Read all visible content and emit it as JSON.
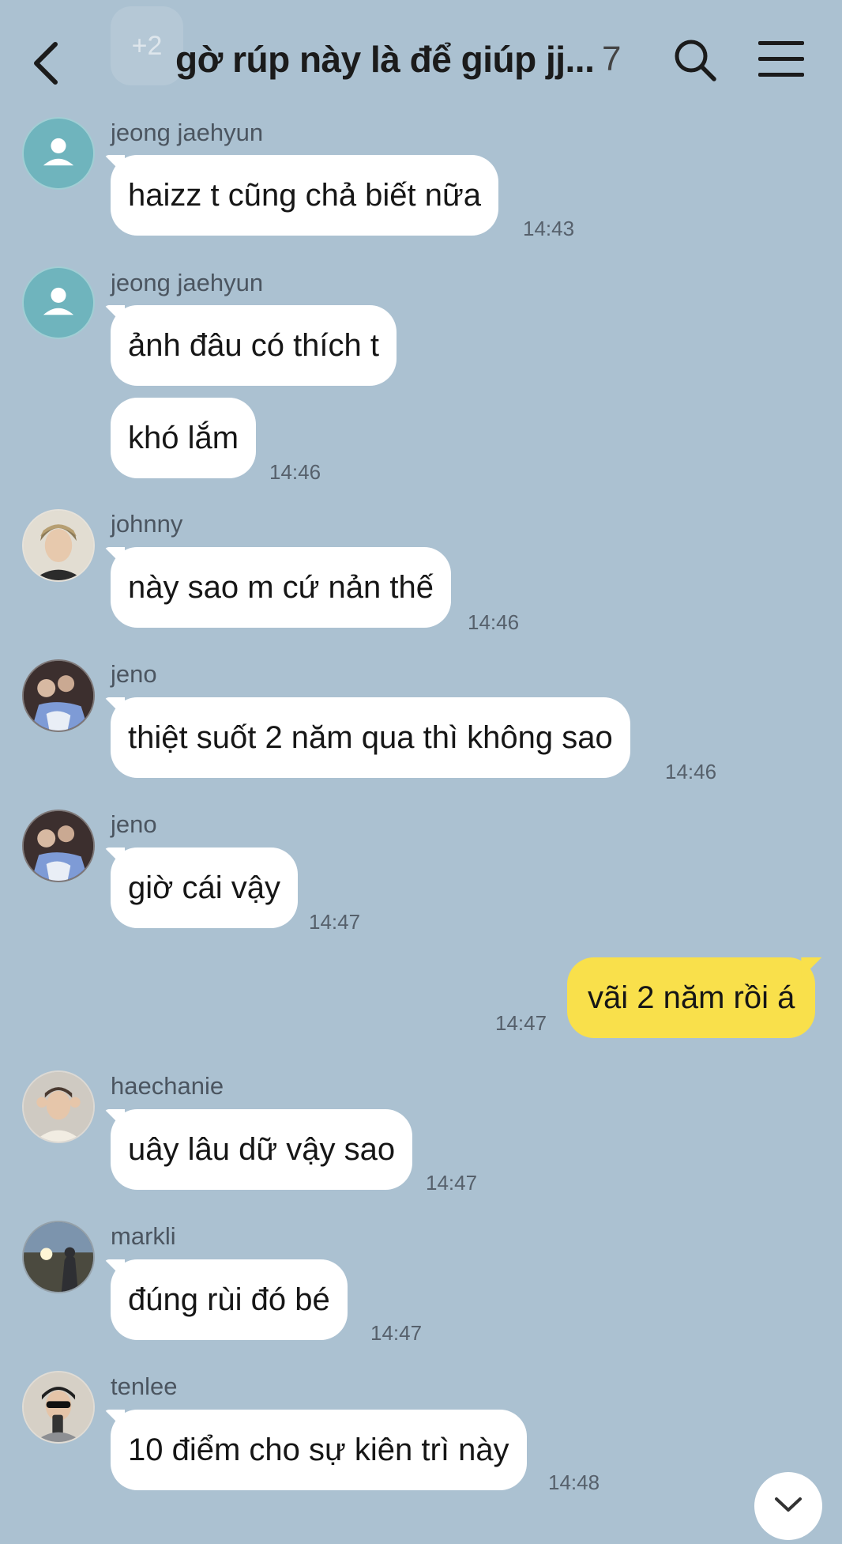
{
  "header": {
    "title": "gờ rúp này là để giúp jj...",
    "member_count": "7",
    "ghost_badge": "+2"
  },
  "messages": [
    {
      "sender": "jeong jaehyun",
      "text": "haizz t cũng chả biết nữa",
      "time": "14:43"
    },
    {
      "sender": "jeong jaehyun",
      "text": "ảnh đâu có thích t"
    },
    {
      "text": "khó lắm",
      "time": "14:46"
    },
    {
      "sender": "johnny",
      "text": "này sao m cứ nản thế",
      "time": "14:46"
    },
    {
      "sender": "jeno",
      "text": "thiệt suốt 2 năm qua thì không sao",
      "time": "14:46"
    },
    {
      "sender": "jeno",
      "text": "giờ cái vậy",
      "time": "14:47"
    },
    {
      "text": "vãi 2 năm rồi á",
      "time": "14:47",
      "mine": true
    },
    {
      "sender": "haechanie",
      "text": "uây lâu dữ vậy sao",
      "time": "14:47"
    },
    {
      "sender": "markli",
      "text": "đúng rùi đó bé",
      "time": "14:47"
    },
    {
      "sender": "tenlee",
      "text": "10 điểm cho sự kiên trì này",
      "time": "14:48"
    }
  ],
  "colors": {
    "background": "#abc1d1",
    "bubble_in": "#ffffff",
    "bubble_out": "#f9e04b",
    "default_avatar": "#6fb4bd"
  },
  "icons": {
    "back": "chevron-left-icon",
    "search": "search-icon",
    "menu": "hamburger-menu-icon",
    "scroll_down": "chevron-down-icon"
  }
}
